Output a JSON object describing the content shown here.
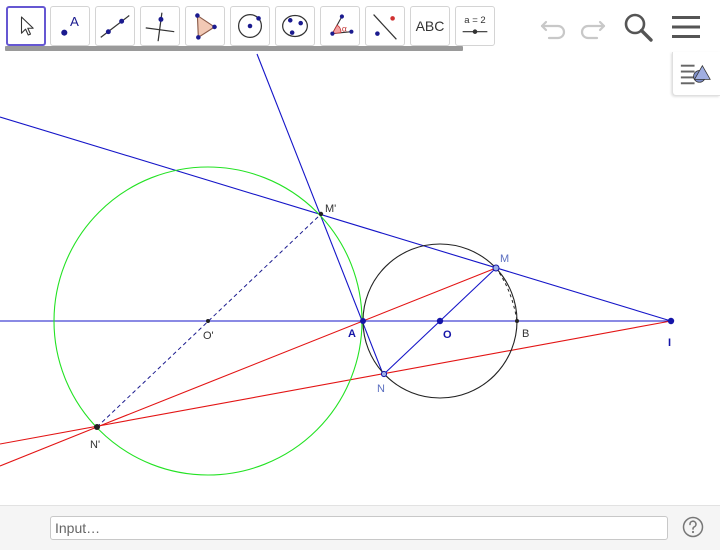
{
  "toolbar": {
    "tools": [
      {
        "name": "move-tool",
        "icon": "cursor-arrow-icon",
        "active": true
      },
      {
        "name": "point-tool",
        "icon": "point-icon",
        "label": "A"
      },
      {
        "name": "line-tool",
        "icon": "line-through-two-points-icon"
      },
      {
        "name": "perpendicular-line-tool",
        "icon": "perpendicular-line-icon"
      },
      {
        "name": "polygon-tool",
        "icon": "polygon-icon"
      },
      {
        "name": "circle-center-point-tool",
        "icon": "circle-center-point-icon"
      },
      {
        "name": "circle-three-points-tool",
        "icon": "circle-three-points-icon"
      },
      {
        "name": "angle-tool",
        "icon": "angle-icon",
        "label": "α"
      },
      {
        "name": "reflect-tool",
        "icon": "reflect-about-line-icon"
      },
      {
        "name": "text-tool",
        "icon": "text-icon",
        "label": "ABC"
      },
      {
        "name": "slider-tool",
        "icon": "slider-icon",
        "label": "a = 2"
      }
    ],
    "undo_icon": "undo-icon",
    "redo_icon": "redo-icon",
    "search_icon": "search-icon",
    "menu_icon": "hamburger-menu-icon"
  },
  "style_bar_icon": "style-bar-toggle-icon",
  "graphics": {
    "labels": {
      "M_prime": "M'",
      "M": "M",
      "O_prime": "O'",
      "A": "A",
      "O": "O",
      "B": "B",
      "N": "N",
      "I": "I",
      "N_prime": "N'"
    },
    "colors": {
      "blue_line": "#1515c8",
      "red_line": "#e31414",
      "green_circle": "#23e223",
      "black_circle": "#222222",
      "point_blue": "#1515a8",
      "label_blue": "#5b6fc0",
      "label_dark": "#333333"
    }
  },
  "input_bar": {
    "placeholder": "Input…",
    "value": ""
  },
  "help_icon": "help-question-icon"
}
